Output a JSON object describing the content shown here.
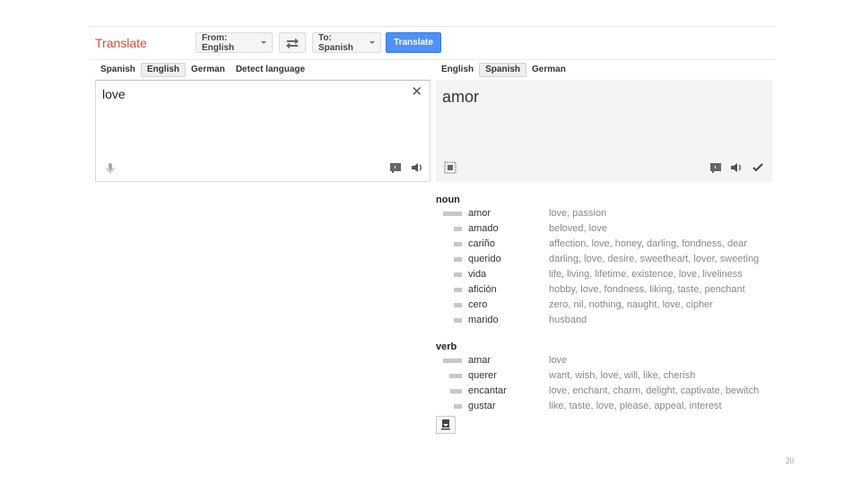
{
  "header": {
    "brand": "Translate",
    "from_label": "From: English",
    "to_label": "To: Spanish",
    "translate_label": "Translate"
  },
  "source": {
    "tabs": [
      {
        "label": "Spanish",
        "active": false
      },
      {
        "label": "English",
        "active": true
      },
      {
        "label": "German",
        "active": false
      },
      {
        "label": "Detect language",
        "active": false
      }
    ],
    "text": "love"
  },
  "target": {
    "tabs": [
      {
        "label": "English",
        "active": false
      },
      {
        "label": "Spanish",
        "active": true
      },
      {
        "label": "German",
        "active": false
      }
    ],
    "text": "amor"
  },
  "dictionary": [
    {
      "pos": "noun",
      "entries": [
        {
          "word": "amor",
          "synonyms": "love, passion",
          "frequency": 1.0
        },
        {
          "word": "amado",
          "synonyms": "beloved, love",
          "frequency": 0.3
        },
        {
          "word": "cariño",
          "synonyms": "affection, love, honey, darling, fondness, dear",
          "frequency": 0.3
        },
        {
          "word": "querido",
          "synonyms": "darling, love, desire, sweetheart, lover, sweeting",
          "frequency": 0.3
        },
        {
          "word": "vida",
          "synonyms": "life, living, lifetime, existence, love, liveliness",
          "frequency": 0.3
        },
        {
          "word": "afición",
          "synonyms": "hobby, love, fondness, liking, taste, penchant",
          "frequency": 0.3
        },
        {
          "word": "cero",
          "synonyms": "zero, nil, nothing, naught, love, cipher",
          "frequency": 0.3
        },
        {
          "word": "marido",
          "synonyms": "husband",
          "frequency": 0.3
        }
      ]
    },
    {
      "pos": "verb",
      "entries": [
        {
          "word": "amar",
          "synonyms": "love",
          "frequency": 1.0
        },
        {
          "word": "querer",
          "synonyms": "want, wish, love, will, like, cherish",
          "frequency": 0.6
        },
        {
          "word": "encantar",
          "synonyms": "love, enchant, charm, delight, captivate, bewitch",
          "frequency": 0.5
        },
        {
          "word": "gustar",
          "synonyms": "like, taste, love, please, appeal, interest",
          "frequency": 0.3
        }
      ]
    }
  ],
  "page_number": "20",
  "colors": {
    "brand": "#dd4b39",
    "primary": "#4d90fe"
  },
  "icons": [
    "swap-icon",
    "clear-icon",
    "microphone-icon",
    "keyboard-icon",
    "speaker-icon",
    "phonetic-icon",
    "check-icon",
    "download-icon"
  ]
}
